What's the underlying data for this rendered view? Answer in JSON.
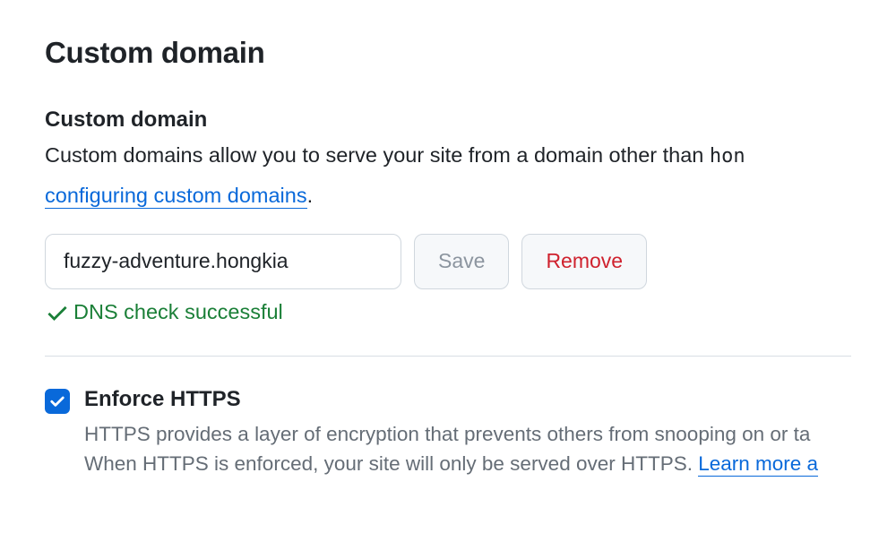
{
  "section": {
    "title": "Custom domain"
  },
  "customDomain": {
    "title": "Custom domain",
    "description_prefix": "Custom domains allow you to serve your site from a domain other than ",
    "description_mono": "hon",
    "link_text": "configuring custom domains",
    "period": ".",
    "input_value": "fuzzy-adventure.hongkia",
    "save_label": "Save",
    "remove_label": "Remove",
    "status_text": "DNS check successful"
  },
  "https": {
    "title": "Enforce HTTPS",
    "desc_line1": "HTTPS provides a layer of encryption that prevents others from snooping on or ta",
    "desc_line2_prefix": "When HTTPS is enforced, your site will only be served over HTTPS. ",
    "learn_more": "Learn more a",
    "checked": true
  }
}
